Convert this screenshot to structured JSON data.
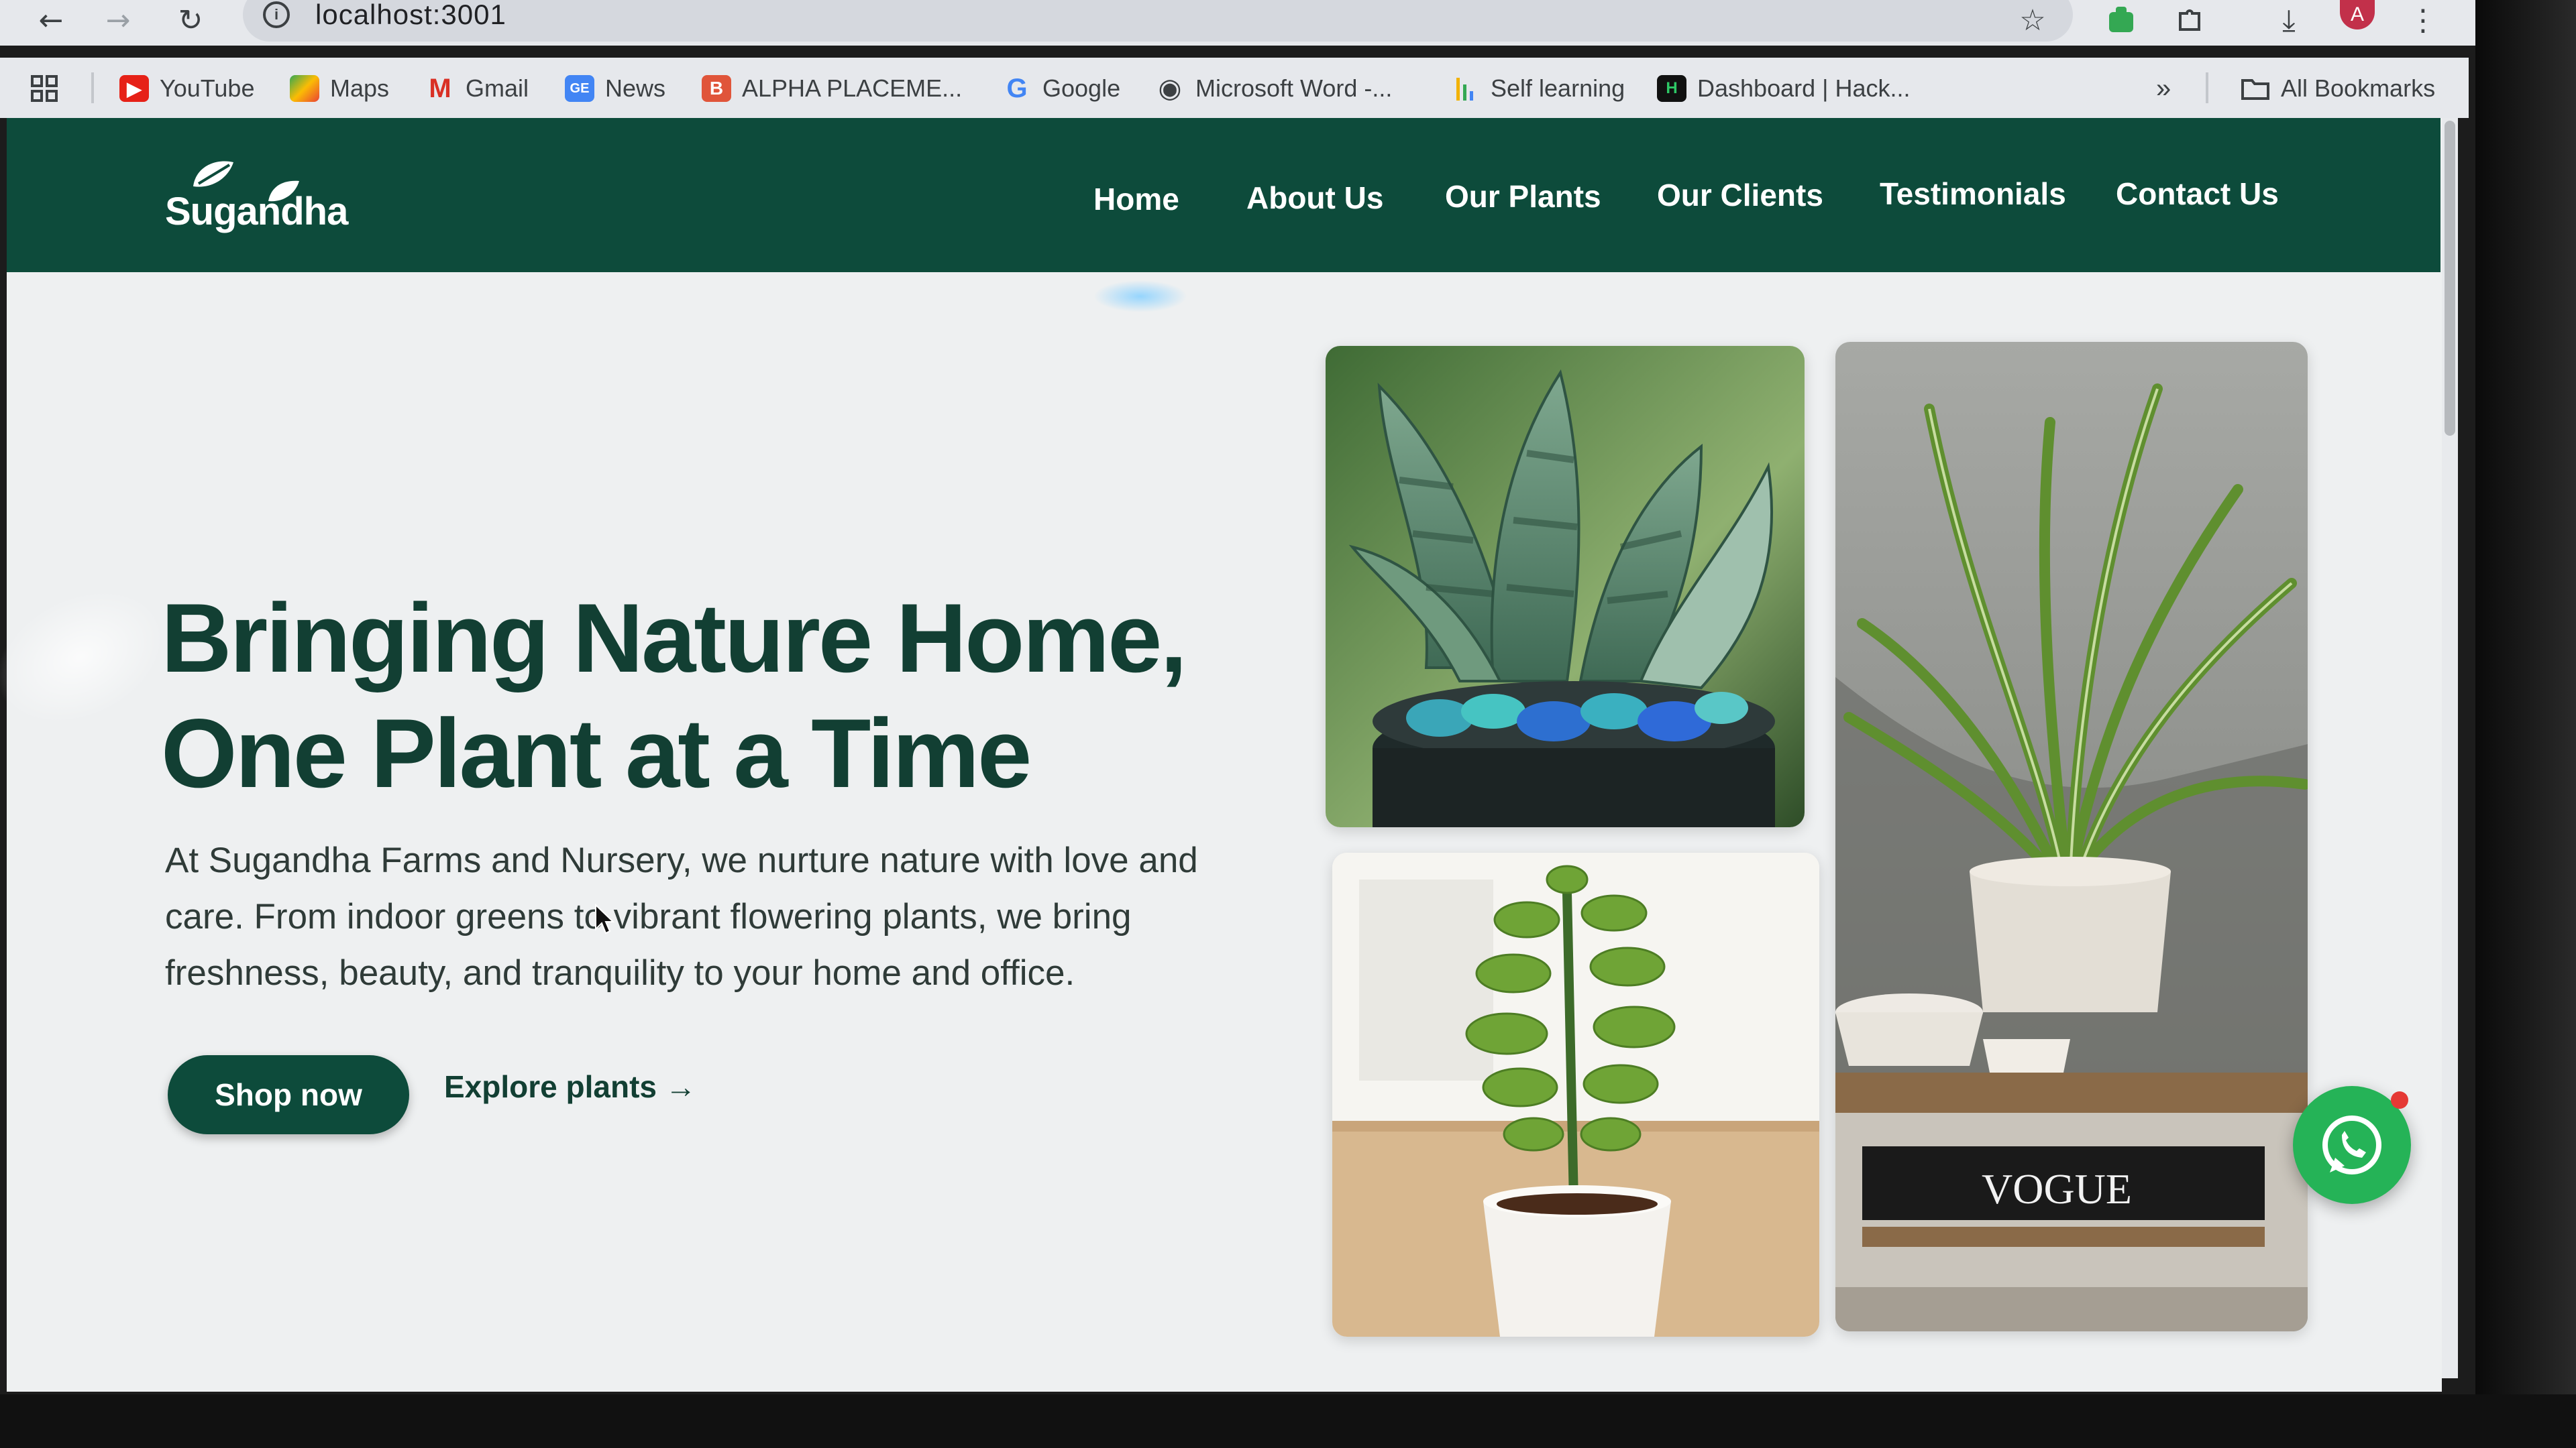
{
  "browser": {
    "url": "localhost:3001",
    "profile_initial": "A",
    "bookmarks": [
      {
        "label": "YouTube",
        "icon": "youtube-icon",
        "color": "#e62117"
      },
      {
        "label": "Maps",
        "icon": "maps-icon",
        "color": "#34a853"
      },
      {
        "label": "Gmail",
        "icon": "gmail-icon",
        "color": "#d93025"
      },
      {
        "label": "News",
        "icon": "news-icon",
        "color": "#4285f4"
      },
      {
        "label": "ALPHA PLACEME...",
        "icon": "blogger-icon",
        "color": "#e0553a"
      },
      {
        "label": "Google",
        "icon": "google-icon",
        "color": "#4285f4"
      },
      {
        "label": "Microsoft Word -...",
        "icon": "globe-icon",
        "color": "#3c4043"
      },
      {
        "label": "Self learning",
        "icon": "bars-icon",
        "color": "#f2b200"
      },
      {
        "label": "Dashboard | Hack...",
        "icon": "hackerrank-icon",
        "color": "#111111"
      }
    ],
    "all_bookmarks_label": "All Bookmarks"
  },
  "site": {
    "logo_text": "Sugandha",
    "nav": [
      {
        "label": "Home"
      },
      {
        "label": "About Us"
      },
      {
        "label": "Our Plants"
      },
      {
        "label": "Our Clients"
      },
      {
        "label": "Testimonials"
      },
      {
        "label": "Contact Us"
      }
    ],
    "hero": {
      "headline_line1": "Bringing Nature Home,",
      "headline_line2": "One Plant at a Time",
      "subtext": "At Sugandha Farms and Nursery, we nurture nature with love and care. From indoor greens to vibrant flowering plants, we bring freshness, beauty, and tranquility to your home and office.",
      "primary_cta": "Shop now",
      "secondary_cta": "Explore plants →"
    },
    "photos": {
      "spider_plant_book_text": "VOGUE"
    }
  },
  "colors": {
    "brand_green": "#0d4b3b",
    "headline_green": "#123f33",
    "whatsapp_green": "#25b357",
    "notification_red": "#e53935"
  }
}
